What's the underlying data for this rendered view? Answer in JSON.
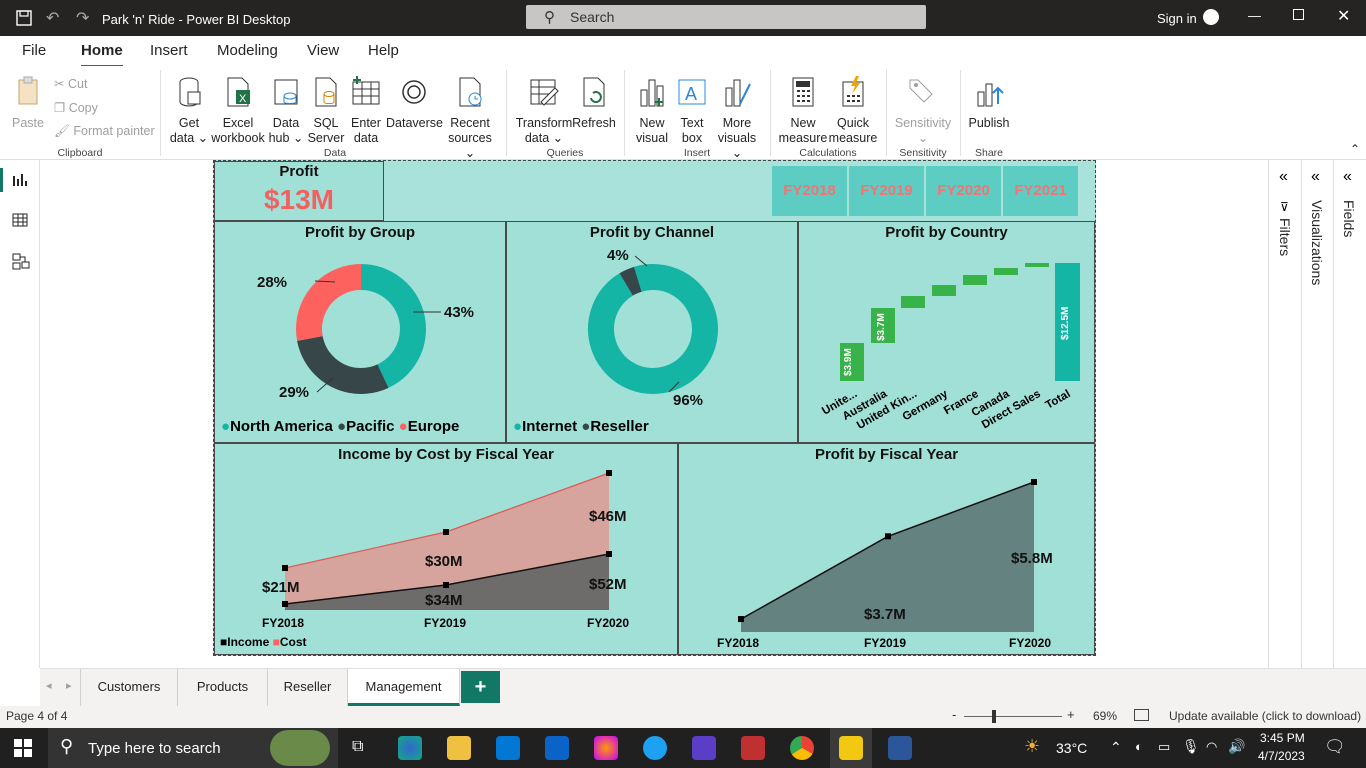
{
  "window": {
    "title": "Park 'n' Ride - Power BI Desktop",
    "search_placeholder": "Search",
    "sign_in": "Sign in"
  },
  "menu": [
    "File",
    "Home",
    "Insert",
    "Modeling",
    "View",
    "Help"
  ],
  "ribbon": {
    "clipboard": {
      "paste": "Paste",
      "cut": "Cut",
      "copy": "Copy",
      "format_painter": "Format painter",
      "group": "Clipboard"
    },
    "data": {
      "get_data": [
        "Get",
        "data ⌄"
      ],
      "excel": [
        "Excel",
        "workbook"
      ],
      "data_hub": [
        "Data",
        "hub ⌄"
      ],
      "sql": [
        "SQL",
        "Server"
      ],
      "enter": [
        "Enter",
        "data"
      ],
      "dataverse": [
        "Dataverse",
        ""
      ],
      "recent": [
        "Recent",
        "sources ⌄"
      ],
      "group": "Data"
    },
    "queries": {
      "transform": [
        "Transform",
        "data ⌄"
      ],
      "refresh": [
        "Refresh",
        ""
      ],
      "group": "Queries"
    },
    "insert": {
      "new_visual": [
        "New",
        "visual"
      ],
      "text_box": [
        "Text",
        "box"
      ],
      "more_visuals": [
        "More",
        "visuals ⌄"
      ],
      "group": "Insert"
    },
    "calculations": {
      "new_measure": [
        "New",
        "measure"
      ],
      "quick_measure": [
        "Quick",
        "measure"
      ],
      "group": "Calculations"
    },
    "sensitivity": {
      "label": "Sensitivity",
      "group": "Sensitivity"
    },
    "share": {
      "publish": "Publish",
      "group": "Share"
    }
  },
  "report": {
    "profit_card": {
      "title": "Profit",
      "value": "$13M"
    },
    "fiscal_slicer": [
      "FY2018",
      "FY2019",
      "FY2020",
      "FY2021"
    ],
    "profit_by_group": {
      "title": "Profit by Group",
      "labels": [
        "43%",
        "29%",
        "28%"
      ],
      "legend": [
        "North America",
        "Pacific",
        "Europe"
      ],
      "colors": [
        "#15b5a6",
        "#374649",
        "#fd625e"
      ]
    },
    "profit_by_channel": {
      "title": "Profit by Channel",
      "labels": [
        "96%",
        "4%"
      ],
      "legend": [
        "Internet",
        "Reseller"
      ],
      "colors": [
        "#15b5a6",
        "#374649"
      ]
    },
    "profit_by_country": {
      "title": "Profit by Country",
      "categories": [
        "Unite...",
        "Australia",
        "United Kin...",
        "Germany",
        "France",
        "Canada",
        "Direct Sales",
        "Total"
      ],
      "data_labels": [
        "$3.9M",
        "$3.7M",
        "$12.5M"
      ]
    },
    "income_cost": {
      "title": "Income by Cost by Fiscal Year",
      "x": [
        "FY2018",
        "FY2019",
        "FY2020"
      ],
      "cost_labels": [
        "$21M",
        "$30M",
        "$46M"
      ],
      "income_labels": [
        "$34M",
        "$52M"
      ],
      "legend": [
        "Income",
        "Cost"
      ]
    },
    "profit_fy": {
      "title": "Profit by Fiscal Year",
      "x": [
        "FY2018",
        "FY2019",
        "FY2020"
      ],
      "labels": [
        "$3.7M",
        "$5.8M"
      ]
    }
  },
  "chart_data": [
    {
      "type": "pie",
      "title": "Profit by Group",
      "categories": [
        "North America",
        "Pacific",
        "Europe"
      ],
      "values": [
        43,
        29,
        28
      ]
    },
    {
      "type": "pie",
      "title": "Profit by Channel",
      "categories": [
        "Internet",
        "Reseller"
      ],
      "values": [
        96,
        4
      ]
    },
    {
      "type": "bar",
      "title": "Profit by Country",
      "categories": [
        "Unite...",
        "Australia",
        "United Kin...",
        "Germany",
        "France",
        "Canada",
        "Direct Sales",
        "Total"
      ],
      "values": [
        3.9,
        3.7,
        1.2,
        1.0,
        0.9,
        0.6,
        0.3,
        12.5
      ]
    },
    {
      "type": "area",
      "title": "Income by Cost by Fiscal Year",
      "x": [
        "FY2018",
        "FY2019",
        "FY2020"
      ],
      "series": [
        {
          "name": "Income",
          "values": [
            21,
            34,
            52
          ]
        },
        {
          "name": "Cost",
          "values": [
            21,
            30,
            46
          ]
        }
      ]
    },
    {
      "type": "area",
      "title": "Profit by Fiscal Year",
      "x": [
        "FY2018",
        "FY2019",
        "FY2020"
      ],
      "values": [
        0.5,
        3.7,
        5.8
      ]
    }
  ],
  "panes": {
    "filters": "Filters",
    "visualizations": "Visualizations",
    "fields": "Fields"
  },
  "tabs": [
    "Customers",
    "Products",
    "Reseller",
    "Management"
  ],
  "status": {
    "page": "Page 4 of 4",
    "zoom": "69%",
    "update": "Update available (click to download)"
  },
  "taskbar": {
    "search": "Type here to search",
    "weather": "33°C",
    "time": "3:45 PM",
    "date": "4/7/2023"
  }
}
